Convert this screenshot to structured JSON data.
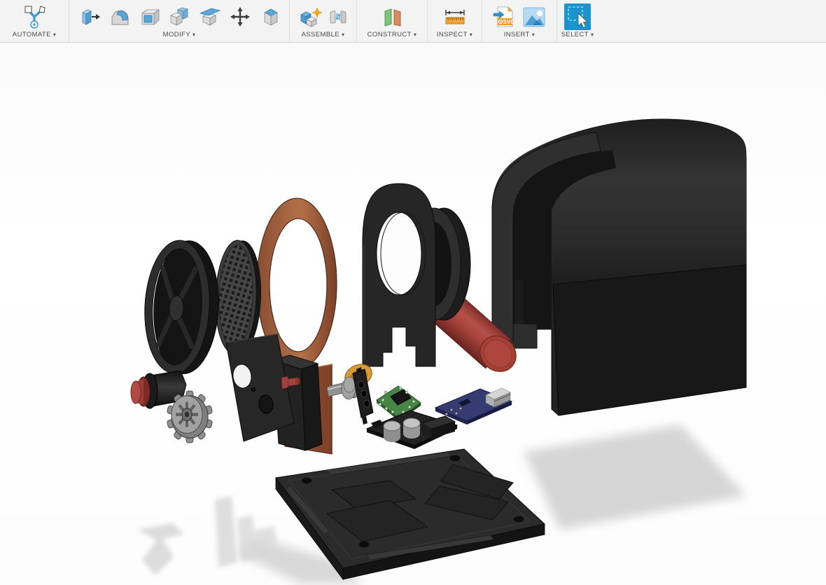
{
  "toolbar": {
    "dropdown_glyph": "▾",
    "insert_svg_badge": "SVG",
    "groups": [
      {
        "id": "automate",
        "label": "AUTOMATE",
        "icons": [
          "automate-icon"
        ]
      },
      {
        "id": "modify",
        "label": "MODIFY",
        "icons": [
          "press-pull-icon",
          "fillet-icon",
          "shell-icon",
          "combine-icon",
          "split-body-icon",
          "move-copy-icon",
          "chamfer-icon"
        ]
      },
      {
        "id": "assemble",
        "label": "ASSEMBLE",
        "icons": [
          "new-component-icon",
          "joint-icon"
        ]
      },
      {
        "id": "construct",
        "label": "CONSTRUCT",
        "icons": [
          "construction-plane-icon"
        ]
      },
      {
        "id": "inspect",
        "label": "INSPECT",
        "icons": [
          "measure-icon"
        ]
      },
      {
        "id": "insert",
        "label": "INSERT",
        "icons": [
          "insert-svg-icon",
          "insert-canvas-icon"
        ]
      },
      {
        "id": "select",
        "label": "SELECT",
        "icons": [
          "select-icon"
        ]
      }
    ]
  },
  "viewport": {
    "scene": "exploded-view-3d-assembly",
    "background": "#fdfdfd",
    "shadow_color": "#d9d9d9",
    "parts": [
      {
        "name": "flywheel",
        "color": "#2d2d2d"
      },
      {
        "name": "mesh-screen-disc",
        "color": "#3c3c3c"
      },
      {
        "name": "copper-arch-frame",
        "color": "#a96447"
      },
      {
        "name": "mount-plate",
        "color": "#272727"
      },
      {
        "name": "heater-block",
        "color": "#222222"
      },
      {
        "name": "dc-motor",
        "color": "#1e1e1e",
        "cap_color": "#b14b41"
      },
      {
        "name": "gear",
        "color": "#a2a2a2"
      },
      {
        "name": "crank-shaft",
        "color": "#919191"
      },
      {
        "name": "cam-disc",
        "color": "#d89a33"
      },
      {
        "name": "green-pcb",
        "color": "#478547"
      },
      {
        "name": "driver-pcb",
        "color": "#222222"
      },
      {
        "name": "usb-pcb",
        "color": "#343c72"
      },
      {
        "name": "bearing-bracket",
        "color": "#262626"
      },
      {
        "name": "piston-cylinder",
        "color": "#a8443b"
      },
      {
        "name": "outer-cover",
        "color": "#232323"
      },
      {
        "name": "base-plate",
        "color": "#2b2b2b"
      }
    ]
  },
  "colors": {
    "toolbar_bg": "#f3f3f3",
    "toolbar_border": "#d4d4d4",
    "label_text": "#4a4a4a",
    "icon_blue": "#4f9fd7",
    "select_blue": "#1a93cf",
    "select_dash": "#8fe8d0",
    "accent_orange": "#f0a63c",
    "plane_green": "#7cc47c",
    "plane_orange": "#d98c5f"
  }
}
